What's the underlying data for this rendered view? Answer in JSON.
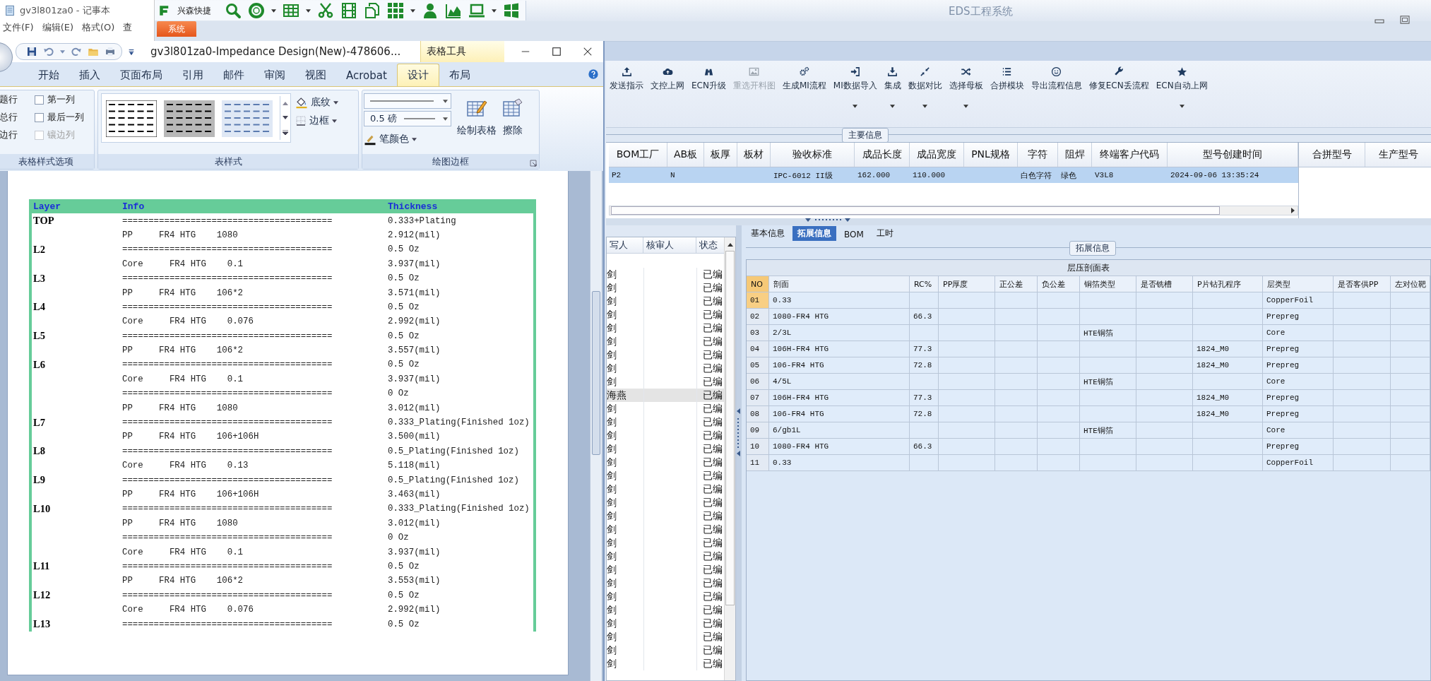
{
  "notepad": {
    "title": "gv3l801za0 - 记事本",
    "menu": [
      "文件(F)",
      "编辑(E)",
      "格式(O)",
      "查"
    ]
  },
  "eds": {
    "title": "EDS工程系统",
    "quick_label": "兴森快捷",
    "menu_tabs": [
      {
        "label": "系统",
        "selected": true
      }
    ],
    "toolbar": [
      {
        "label": "发送指示",
        "disabled": false,
        "dropdown": false
      },
      {
        "label": "文控上网",
        "disabled": false,
        "dropdown": false
      },
      {
        "label": "ECN升级",
        "disabled": false,
        "dropdown": false
      },
      {
        "label": "重选开料图",
        "disabled": true,
        "dropdown": false
      },
      {
        "label": "生成MI流程",
        "disabled": false,
        "dropdown": false
      },
      {
        "label": "MI数据导入",
        "disabled": false,
        "dropdown": true
      },
      {
        "label": "集成",
        "disabled": false,
        "dropdown": true
      },
      {
        "label": "数据对比",
        "disabled": false,
        "dropdown": true
      },
      {
        "label": "选择母板",
        "disabled": false,
        "dropdown": true
      },
      {
        "label": "合拼模块",
        "disabled": false,
        "dropdown": false
      },
      {
        "label": "导出流程信息",
        "disabled": false,
        "dropdown": false
      },
      {
        "label": "修复ECN丢流程",
        "disabled": false,
        "dropdown": false
      },
      {
        "label": "ECN自动上网",
        "disabled": false,
        "dropdown": true
      }
    ],
    "main_info": {
      "group": "主要信息",
      "columns": [
        "BOM工厂",
        "AB板",
        "板厚",
        "板材",
        "验收标准",
        "成品长度",
        "成品宽度",
        "PNL规格",
        "字符",
        "阻焊",
        "终端客户代码",
        "型号创建时间"
      ],
      "rows": [
        {
          "selected": true,
          "cells": [
            "P2",
            "N",
            null,
            null,
            "IPC-6012 II级",
            "162.000",
            "110.000",
            null,
            "白色字符",
            "绿色",
            "V3L8",
            "2024-09-06 13:35:24"
          ]
        }
      ],
      "side_columns": [
        "合拼型号",
        "生产型号"
      ]
    },
    "list": {
      "columns": [
        "写人",
        "核审人",
        "状态"
      ],
      "rows": [
        {
          "writer": "剑",
          "status": "已编",
          "selected": false
        },
        {
          "writer": "剑",
          "status": "已编",
          "selected": false
        },
        {
          "writer": "剑",
          "status": "已编",
          "selected": false
        },
        {
          "writer": "剑",
          "status": "已编",
          "selected": false
        },
        {
          "writer": "剑",
          "status": "已编",
          "selected": false
        },
        {
          "writer": "剑",
          "status": "已编",
          "selected": false
        },
        {
          "writer": "剑",
          "status": "已编",
          "selected": false
        },
        {
          "writer": "剑",
          "status": "已编",
          "selected": false
        },
        {
          "writer": "剑",
          "status": "已编",
          "selected": false
        },
        {
          "writer": "海燕",
          "status": "已编",
          "selected": true
        },
        {
          "writer": "剑",
          "status": "已编",
          "selected": false
        },
        {
          "writer": "剑",
          "status": "已编",
          "selected": false
        },
        {
          "writer": "剑",
          "status": "已编",
          "selected": false
        },
        {
          "writer": "剑",
          "status": "已编",
          "selected": false
        },
        {
          "writer": "剑",
          "status": "已编",
          "selected": false
        },
        {
          "writer": "剑",
          "status": "已编",
          "selected": false
        },
        {
          "writer": "剑",
          "status": "已编",
          "selected": false
        },
        {
          "writer": "剑",
          "status": "已编",
          "selected": false
        },
        {
          "writer": "剑",
          "status": "已编",
          "selected": false
        },
        {
          "writer": "剑",
          "status": "已编",
          "selected": false
        },
        {
          "writer": "剑",
          "status": "已编",
          "selected": false
        },
        {
          "writer": "剑",
          "status": "已编",
          "selected": false
        },
        {
          "writer": "剑",
          "status": "已编",
          "selected": false
        },
        {
          "writer": "剑",
          "status": "已编",
          "selected": false
        },
        {
          "writer": "剑",
          "status": "已编",
          "selected": false
        },
        {
          "writer": "剑",
          "status": "已编",
          "selected": false
        },
        {
          "writer": "剑",
          "status": "已编",
          "selected": false
        },
        {
          "writer": "剑",
          "status": "已编",
          "selected": false
        },
        {
          "writer": "剑",
          "status": "已编",
          "selected": false
        },
        {
          "writer": "剑",
          "status": "已编",
          "selected": false
        }
      ]
    },
    "detail": {
      "tabs": [
        {
          "label": "基本信息",
          "selected": false
        },
        {
          "label": "拓展信息",
          "selected": true
        },
        {
          "label": "BOM",
          "selected": false
        },
        {
          "label": "工时",
          "selected": false
        }
      ],
      "group": "拓展信息",
      "table": {
        "title": "层压剖面表",
        "columns": [
          "NO",
          "剖面",
          "RC%",
          "PP厚度",
          "正公差",
          "负公差",
          "铜箔类型",
          "是否铣槽",
          "P片钻孔程序",
          "层类型",
          "是否客供PP",
          "左对位靶"
        ],
        "rows": [
          {
            "selected": true,
            "cells": [
              "01",
              "0.33",
              null,
              null,
              null,
              null,
              null,
              null,
              null,
              "CopperFoil",
              null,
              null
            ]
          },
          {
            "selected": false,
            "cells": [
              "02",
              "1080-FR4 HTG",
              "66.3",
              null,
              null,
              null,
              null,
              null,
              null,
              "Prepreg",
              null,
              null
            ]
          },
          {
            "selected": false,
            "cells": [
              "03",
              "2/3L",
              null,
              null,
              null,
              null,
              "HTE铜箔",
              null,
              null,
              "Core",
              null,
              null
            ]
          },
          {
            "selected": false,
            "cells": [
              "04",
              "106H-FR4 HTG",
              "77.3",
              null,
              null,
              null,
              null,
              null,
              "1824_M0",
              "Prepreg",
              null,
              null
            ]
          },
          {
            "selected": false,
            "cells": [
              "05",
              "106-FR4 HTG",
              "72.8",
              null,
              null,
              null,
              null,
              null,
              "1824_M0",
              "Prepreg",
              null,
              null
            ]
          },
          {
            "selected": false,
            "cells": [
              "06",
              "4/5L",
              null,
              null,
              null,
              null,
              "HTE铜箔",
              null,
              null,
              "Core",
              null,
              null
            ]
          },
          {
            "selected": false,
            "cells": [
              "07",
              "106H-FR4 HTG",
              "77.3",
              null,
              null,
              null,
              null,
              null,
              "1824_M0",
              "Prepreg",
              null,
              null
            ]
          },
          {
            "selected": false,
            "cells": [
              "08",
              "106-FR4 HTG",
              "72.8",
              null,
              null,
              null,
              null,
              null,
              "1824_M0",
              "Prepreg",
              null,
              null
            ]
          },
          {
            "selected": false,
            "cells": [
              "09",
              "6/gb1L",
              null,
              null,
              null,
              null,
              "HTE铜箔",
              null,
              null,
              "Core",
              null,
              null
            ]
          },
          {
            "selected": false,
            "cells": [
              "10",
              "1080-FR4 HTG",
              "66.3",
              null,
              null,
              null,
              null,
              null,
              null,
              "Prepreg",
              null,
              null
            ]
          },
          {
            "selected": false,
            "cells": [
              "11",
              "0.33",
              null,
              null,
              null,
              null,
              null,
              null,
              null,
              "CopperFoil",
              null,
              null
            ]
          }
        ]
      }
    }
  },
  "word": {
    "title": "gv3l801za0-Impedance Design(New)-478606...",
    "context_label": "表格工具",
    "tabs": [
      {
        "label": "开始",
        "selected": false
      },
      {
        "label": "插入",
        "selected": false
      },
      {
        "label": "页面布局",
        "selected": false
      },
      {
        "label": "引用",
        "selected": false
      },
      {
        "label": "邮件",
        "selected": false
      },
      {
        "label": "审阅",
        "selected": false
      },
      {
        "label": "视图",
        "selected": false
      },
      {
        "label": "Acrobat",
        "selected": false
      },
      {
        "label": "设计",
        "selected": true
      },
      {
        "label": "布局",
        "selected": false
      }
    ],
    "ribbon": {
      "row_options": [
        "题行",
        "总行",
        "边行"
      ],
      "checkboxes": [
        {
          "label": "第一列",
          "checked": false,
          "disabled": false
        },
        {
          "label": "最后一列",
          "checked": false,
          "disabled": false
        },
        {
          "label": "镶边列",
          "checked": false,
          "disabled": true
        }
      ],
      "group1": "表格样式选项",
      "shading": "底纹",
      "borders": "边框",
      "group2": "表样式",
      "weight": "0.5 磅",
      "pen_color": "笔颜色",
      "draw_table": "绘制表格",
      "eraser": "擦除",
      "group3": "绘图边框"
    },
    "document": {
      "columns": [
        "Layer",
        "Info",
        "Thickness"
      ],
      "rows": [
        {
          "layer": "TOP",
          "info": "========================================",
          "thickness": "0.333+Plating"
        },
        {
          "info": "PP     FR4 HTG    1080",
          "thickness": "2.912(mil)"
        },
        {
          "layer": "L2",
          "info": "========================================",
          "thickness": "0.5 Oz"
        },
        {
          "info": "Core     FR4 HTG    0.1",
          "thickness": "3.937(mil)"
        },
        {
          "layer": "L3",
          "info": "========================================",
          "thickness": "0.5 Oz"
        },
        {
          "info": "PP     FR4 HTG    106*2",
          "thickness": "3.571(mil)"
        },
        {
          "layer": "L4",
          "info": "========================================",
          "thickness": "0.5 Oz"
        },
        {
          "info": "Core     FR4 HTG    0.076",
          "thickness": "2.992(mil)"
        },
        {
          "layer": "L5",
          "info": "========================================",
          "thickness": "0.5 Oz"
        },
        {
          "info": "PP     FR4 HTG    106*2",
          "thickness": "3.557(mil)"
        },
        {
          "layer": "L6",
          "info": "========================================",
          "thickness": "0.5 Oz"
        },
        {
          "info": "Core     FR4 HTG    0.1",
          "thickness": "3.937(mil)"
        },
        {
          "info": "========================================",
          "thickness": "0 Oz"
        },
        {
          "info": "PP     FR4 HTG    1080",
          "thickness": "3.012(mil)"
        },
        {
          "layer": "L7",
          "info": "========================================",
          "thickness": "0.333_Plating(Finished 1oz)"
        },
        {
          "info": "PP     FR4 HTG    106+106H",
          "thickness": "3.500(mil)"
        },
        {
          "layer": "L8",
          "info": "========================================",
          "thickness": "0.5_Plating(Finished 1oz)"
        },
        {
          "info": "Core     FR4 HTG    0.13",
          "thickness": "5.118(mil)"
        },
        {
          "layer": "L9",
          "info": "========================================",
          "thickness": "0.5_Plating(Finished 1oz)"
        },
        {
          "info": "PP     FR4 HTG    106+106H",
          "thickness": "3.463(mil)"
        },
        {
          "layer": "L10",
          "info": "========================================",
          "thickness": "0.333_Plating(Finished 1oz)"
        },
        {
          "info": "PP     FR4 HTG    1080",
          "thickness": "3.012(mil)"
        },
        {
          "info": "========================================",
          "thickness": "0 Oz"
        },
        {
          "info": "Core     FR4 HTG    0.1",
          "thickness": "3.937(mil)"
        },
        {
          "layer": "L11",
          "info": "========================================",
          "thickness": "0.5 Oz"
        },
        {
          "info": "PP     FR4 HTG    106*2",
          "thickness": "3.553(mil)"
        },
        {
          "layer": "L12",
          "info": "========================================",
          "thickness": "0.5 Oz"
        },
        {
          "info": "Core     FR4 HTG    0.076",
          "thickness": "2.992(mil)"
        },
        {
          "layer": "L13",
          "info": "========================================",
          "thickness": "0.5 Oz"
        }
      ]
    }
  }
}
